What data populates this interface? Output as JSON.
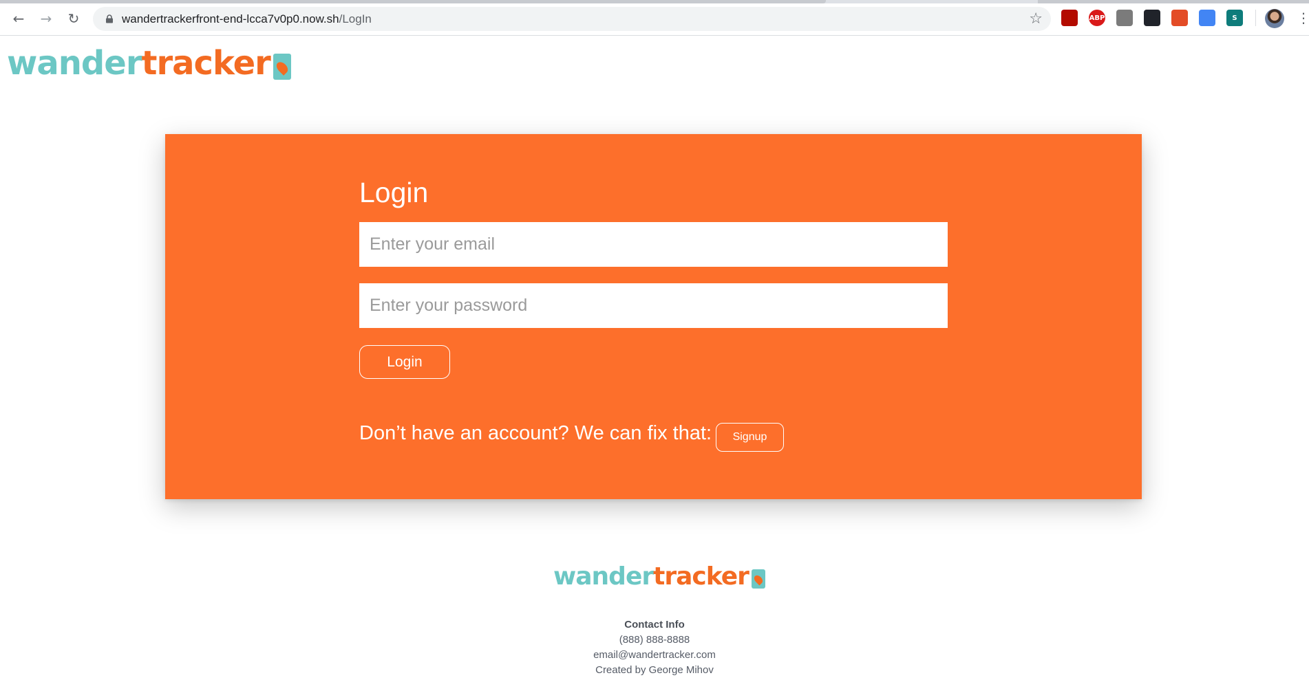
{
  "browser": {
    "url_host": "wandertrackerfront-end-lcca7v0p0.now.sh",
    "url_path": "/LogIn",
    "back_glyph": "←",
    "forward_glyph": "→",
    "reload_glyph": "↻",
    "star_glyph": "☆",
    "menu_glyph": "⋮",
    "extensions": [
      {
        "name": "acrobat-icon",
        "label": "",
        "color": "#b30b00"
      },
      {
        "name": "adblock-icon",
        "label": "ABP",
        "color": "#d91a1a"
      },
      {
        "name": "cube-icon",
        "label": "",
        "color": "#7b7b7b"
      },
      {
        "name": "react-devtools-icon",
        "label": "",
        "color": "#20232a"
      },
      {
        "name": "color-picker-icon",
        "label": "",
        "color": "#e34c26"
      },
      {
        "name": "pen-tool-icon",
        "label": "",
        "color": "#4285f4"
      },
      {
        "name": "stylus-icon",
        "label": "S",
        "color": "#0e7c7b"
      }
    ]
  },
  "brand": {
    "wander": "wander",
    "tracker": "tracker",
    "teal": "#6cc7c4",
    "orange": "#f36b22"
  },
  "login": {
    "title": "Login",
    "email_placeholder": "Enter your email",
    "password_placeholder": "Enter your password",
    "submit_label": "Login",
    "signup_prompt": "Don’t have an account? We can fix that:",
    "signup_label": "Signup",
    "card_color": "#fd6f2b"
  },
  "footer": {
    "heading": "Contact Info",
    "phone": "(888) 888-8888",
    "email": "email@wandertracker.com",
    "credit": "Created by George Mihov"
  }
}
